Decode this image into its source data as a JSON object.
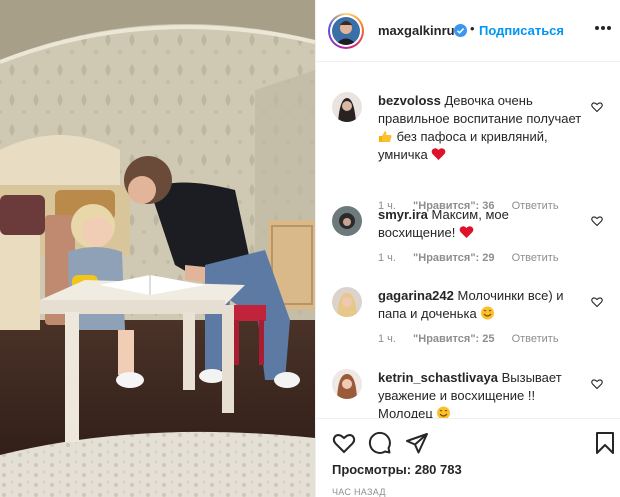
{
  "post": {
    "username": "maxgalkinru",
    "separator": "•",
    "follow_label": "Подписаться",
    "views_label": "Просмотры:",
    "views_count": "280 783",
    "time": "ЧАС НАЗАД"
  },
  "comments": [
    {
      "username": "bezvoloss",
      "text_parts": [
        "Девочка очень правильное воспитание получает",
        "без пафоса и кривляний, умничка"
      ],
      "time": "1 ч.",
      "likes": "\"Нравится\": 36",
      "reply": "Ответить"
    },
    {
      "username": "smyr.ira",
      "text_parts": [
        "Максим, мое восхищение!"
      ],
      "time": "1 ч.",
      "likes": "\"Нравится\": 29",
      "reply": "Ответить"
    },
    {
      "username": "gagarina242",
      "text_parts": [
        "Молочинки все) и папа и доченька"
      ],
      "time": "1 ч.",
      "likes": "\"Нравится\": 25",
      "reply": "Ответить"
    },
    {
      "username": "ketrin_schastlivaya",
      "text_parts": [
        "Вызывает уважение и восхищение !! Молодец"
      ]
    }
  ],
  "icons": {
    "verified": "verified-badge-icon",
    "more": "more-options-icon",
    "like": "heart-icon",
    "comment": "comment-icon",
    "share": "share-icon",
    "save": "bookmark-icon"
  },
  "colors": {
    "link_blue": "#0095f6",
    "verified_blue": "#3897f0",
    "heart_red": "#ed4956",
    "meta_gray": "#8e8e8e",
    "text": "#262626"
  }
}
